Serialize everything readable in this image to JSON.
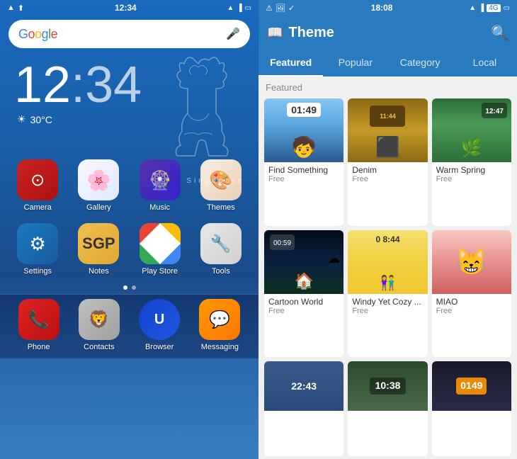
{
  "left": {
    "status_bar": {
      "time": "12:34",
      "icons": [
        "notification",
        "upload"
      ]
    },
    "search": {
      "placeholder": "Google",
      "mic_label": "mic"
    },
    "clock": {
      "hour": "12",
      "colon": ":",
      "minute": "34"
    },
    "weather": {
      "temp": "30°C"
    },
    "location": "Singapore",
    "apps_row1": [
      {
        "name": "Camera",
        "icon": "camera"
      },
      {
        "name": "Gallery",
        "icon": "gallery"
      },
      {
        "name": "Music",
        "icon": "music"
      },
      {
        "name": "Themes",
        "icon": "themes"
      }
    ],
    "apps_row2": [
      {
        "name": "Settings",
        "icon": "settings"
      },
      {
        "name": "Notes",
        "icon": "notes"
      },
      {
        "name": "Play Store",
        "icon": "playstore"
      },
      {
        "name": "Tools",
        "icon": "tools"
      }
    ],
    "dock": [
      {
        "name": "Phone",
        "icon": "phone"
      },
      {
        "name": "Contacts",
        "icon": "contacts"
      },
      {
        "name": "Browser",
        "icon": "browser"
      },
      {
        "name": "Messaging",
        "icon": "messaging"
      }
    ]
  },
  "right": {
    "status_bar": {
      "time": "18:08",
      "icons": [
        "warning",
        "image",
        "check"
      ]
    },
    "header": {
      "title": "Theme",
      "book_icon": "book",
      "search_icon": "search"
    },
    "tabs": [
      {
        "label": "Featured",
        "active": true
      },
      {
        "label": "Popular",
        "active": false
      },
      {
        "label": "Category",
        "active": false
      },
      {
        "label": "Local",
        "active": false
      }
    ],
    "section_label": "Featured",
    "themes": [
      {
        "name": "Find Something",
        "price": "Free",
        "time": "01:49",
        "bg": "find"
      },
      {
        "name": "Denim",
        "price": "Free",
        "time": "11:44",
        "bg": "denim"
      },
      {
        "name": "Warm Spring",
        "price": "Free",
        "time": "12:47",
        "bg": "warm"
      },
      {
        "name": "Cartoon World",
        "price": "Free",
        "time": "00:59",
        "bg": "cartoon"
      },
      {
        "name": "Windy Yet Cozy ...",
        "price": "Free",
        "time": "08:44",
        "bg": "windy"
      },
      {
        "name": "MIAO",
        "price": "Free",
        "time": "",
        "bg": "miao"
      },
      {
        "name": "",
        "price": "",
        "time": "22:43",
        "bg": "bottom1"
      },
      {
        "name": "",
        "price": "",
        "time": "10:38",
        "bg": "bottom2"
      },
      {
        "name": "",
        "price": "",
        "time": "01:49",
        "bg": "bottom3"
      }
    ]
  }
}
